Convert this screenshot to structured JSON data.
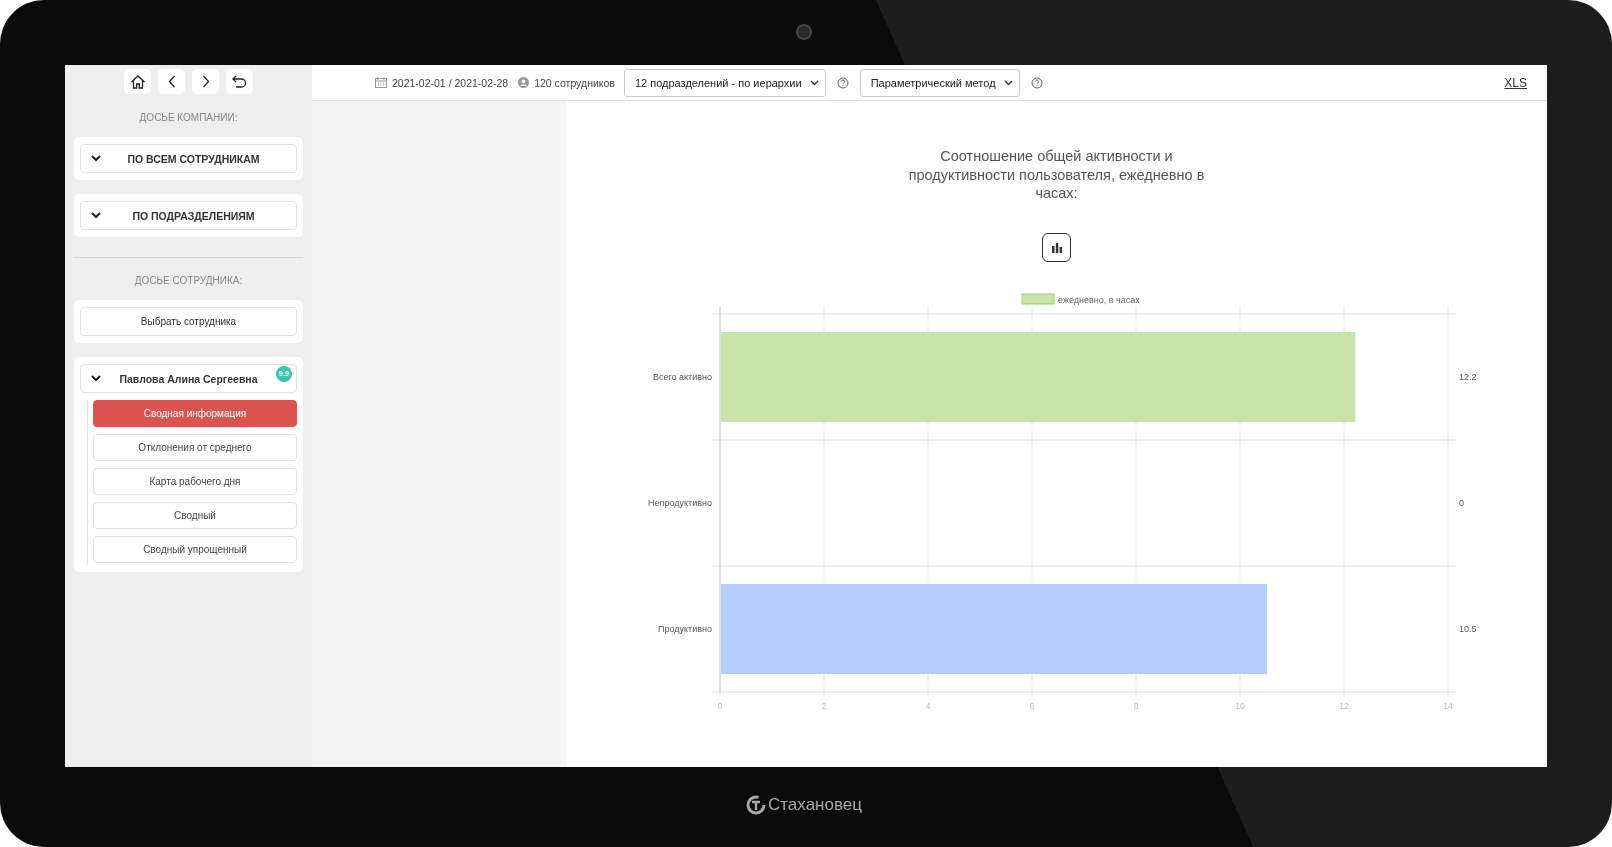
{
  "device": {
    "brand": "Стахановец"
  },
  "sidebar": {
    "company_heading": "ДОСЬЕ КОМПАНИИ:",
    "company_groups": [
      {
        "label": "ПО ВСЕМ СОТРУДНИКАМ"
      },
      {
        "label": "ПО ПОДРАЗДЕЛЕНИЯМ"
      }
    ],
    "employee_heading": "ДОСЬЕ СОТРУДНИКА:",
    "select_employee": "Выбрать сотрудника",
    "employee": {
      "name": "Павлова Алина Сергеевна",
      "score": "9.9",
      "items": [
        {
          "label": "Сводная информация",
          "selected": true
        },
        {
          "label": "Отклонения от среднего",
          "selected": false
        },
        {
          "label": "Карта рабочего дня",
          "selected": false
        },
        {
          "label": "Сводный",
          "selected": false
        },
        {
          "label": "Сводный упрощенный",
          "selected": false
        }
      ]
    }
  },
  "toolbar": {
    "period": "2021-02-01 / 2021-02-28",
    "employees": "120 сотрудников",
    "dropdowns": [
      {
        "value": "12 подразделений - по иерархии"
      },
      {
        "value": "Параметрический метод"
      }
    ],
    "export_link": "XLS"
  },
  "chart": {
    "title": "Соотношение общей активности и продуктивности пользователя, ежедневно в часах:",
    "chart_data": {
      "type": "bar",
      "orientation": "horizontal",
      "categories": [
        "Всего активно",
        "Непродуктивно",
        "Продуктивно"
      ],
      "series": [
        {
          "name": "ежедневно, в часах",
          "color": "#c9e4aa",
          "values": [
            12.2,
            0,
            null
          ]
        },
        {
          "color": "#b3cefb",
          "values": [
            null,
            null,
            10.5
          ]
        }
      ],
      "grid": true,
      "xlim": [
        0,
        14
      ],
      "xticks": [
        0,
        2,
        4,
        6,
        8,
        10,
        12,
        14
      ],
      "value_labels": [
        "12.2",
        "0",
        "10.5"
      ]
    }
  }
}
